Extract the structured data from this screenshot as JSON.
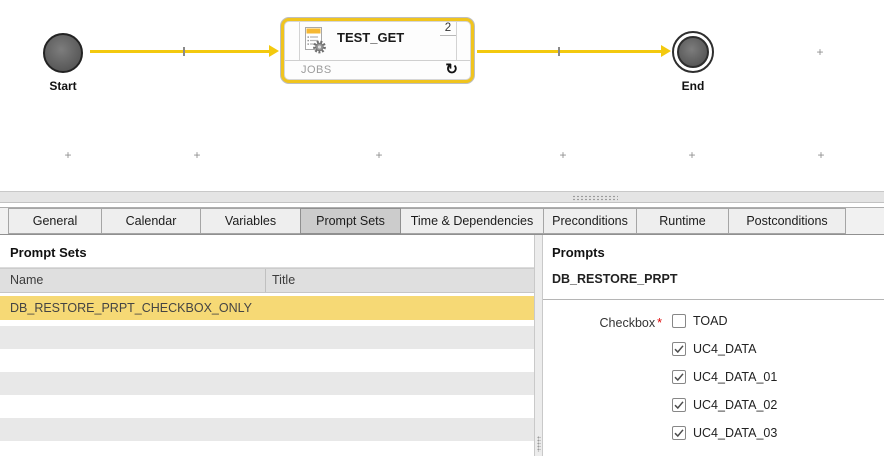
{
  "workflow": {
    "start_label": "Start",
    "end_label": "End",
    "job_box": {
      "title": "TEST_GET",
      "type_label": "JOBS",
      "count_badge": "2",
      "restart_icon": "↻"
    },
    "grid_marker": "+"
  },
  "tabs": {
    "selected": "Prompt Sets",
    "labels": [
      "General",
      "Calendar",
      "Variables",
      "Prompt Sets",
      "Time & Dependencies",
      "Preconditions",
      "Runtime",
      "Postconditions"
    ]
  },
  "prompt_sets_panel": {
    "title": "Prompt Sets",
    "columns": {
      "name": "Name",
      "title": "Title"
    },
    "selected_row": {
      "name": "DB_RESTORE_PRPT_CHECKBOX_ONLY",
      "title": ""
    },
    "empty_row_count": 6
  },
  "prompts_panel": {
    "title": "Prompts",
    "prompt_set_name": "DB_RESTORE_PRPT",
    "field_label": "Checkbox",
    "required_marker": "*",
    "options": [
      {
        "label": "TOAD",
        "checked": false
      },
      {
        "label": "UC4_DATA",
        "checked": true
      },
      {
        "label": "UC4_DATA_01",
        "checked": true
      },
      {
        "label": "UC4_DATA_02",
        "checked": true
      },
      {
        "label": "UC4_DATA_03",
        "checked": true
      }
    ]
  },
  "colors": {
    "accent_yellow": "#f0c41e",
    "arrow_yellow": "#f3c90e",
    "selection_yellow": "#f6d975",
    "selected_tab_bg": "#cccccc",
    "alt_row_gray": "#e8e8e8",
    "required_red": "#dd0000"
  }
}
